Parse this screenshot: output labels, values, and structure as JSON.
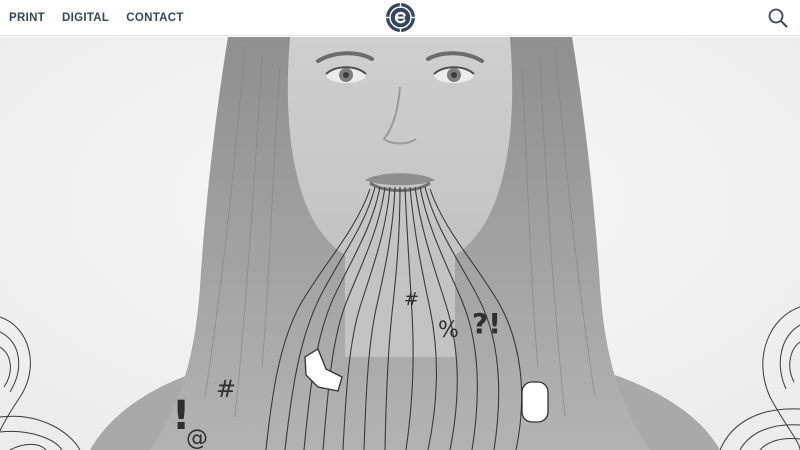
{
  "header": {
    "nav": [
      {
        "label": "PRINT"
      },
      {
        "label": "DIGITAL"
      },
      {
        "label": "CONTACT"
      }
    ],
    "logo_icon": "compass-e-logo-icon",
    "search_icon": "search-icon"
  },
  "hero": {
    "graphic_glyphs": [
      "!",
      "@",
      "#",
      "%",
      "?!",
      "#"
    ]
  },
  "colors": {
    "nav_text": "#34465f",
    "logo_blue": "#34465f",
    "header_border": "#e2e4e8",
    "hero_background": "#f4f4f4"
  }
}
